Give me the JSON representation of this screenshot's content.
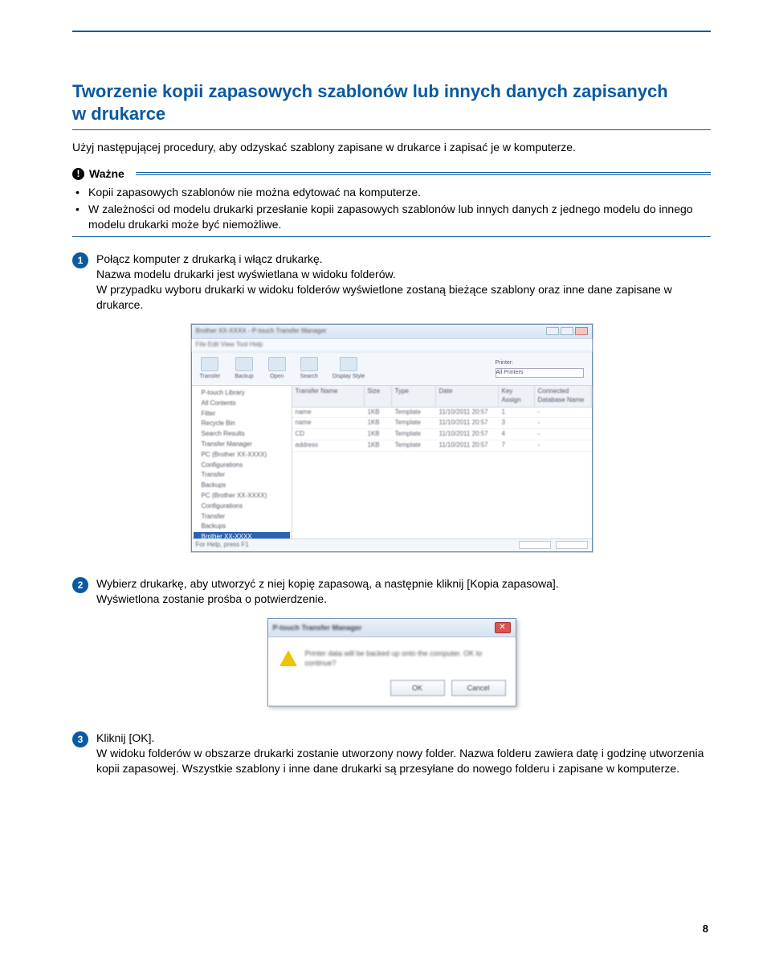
{
  "page_number": "8",
  "title_line1": "Tworzenie kopii zapasowych szablonów lub innych danych zapisanych",
  "title_line2": "w drukarce",
  "intro": "Użyj następującej procedury, aby odzyskać szablony zapisane w drukarce i zapisać je w komputerze.",
  "note": {
    "label": "Ważne",
    "items": [
      "Kopii zapasowych szablonów nie można edytować na komputerze.",
      "W zależności od modelu drukarki przesłanie kopii zapasowych szablonów lub innych danych z jednego modelu do innego modelu drukarki może być niemożliwe."
    ]
  },
  "steps": {
    "s1": {
      "num": "1",
      "p1": "Połącz komputer z drukarką i włącz drukarkę.",
      "p2": "Nazwa modelu drukarki jest wyświetlana w widoku folderów.",
      "p3": "W przypadku wyboru drukarki w widoku folderów wyświetlone zostaną bieżące szablony oraz inne dane zapisane w drukarce."
    },
    "s2": {
      "num": "2",
      "p1": "Wybierz drukarkę, aby utworzyć z niej kopię zapasową, a następnie kliknij [Kopia zapasowa].",
      "p2": "Wyświetlona zostanie prośba o potwierdzenie."
    },
    "s3": {
      "num": "3",
      "p1": "Kliknij [OK].",
      "p2": "W widoku folderów w obszarze drukarki zostanie utworzony nowy folder. Nazwa folderu zawiera datę i godzinę utworzenia kopii zapasowej. Wszystkie szablony i inne dane drukarki są przesyłane do nowego folderu i zapisane w komputerze."
    }
  },
  "tm": {
    "title": "Brother XX-XXXX - P-touch Transfer Manager",
    "menu": "File  Edit  View  Tool  Help",
    "toolbar": [
      "Transfer",
      "Backup",
      "Open",
      "Search",
      "Display Style"
    ],
    "printer_label": "Printer:",
    "printer_value": "All Printers",
    "tree": [
      "P-touch Library",
      "  All Contents",
      "  Filter",
      "  Recycle Bin",
      "  Search Results",
      "Transfer Manager",
      "  PC (Brother XX-XXXX)",
      "    Configurations",
      "    Transfer",
      "    Backups",
      "  PC (Brother XX-XXXX)",
      "    Configurations",
      "    Transfer",
      "    Backups",
      "  Brother XX-XXXX"
    ],
    "tree_selected_index": 14,
    "columns": [
      "Transfer Name",
      "Size",
      "Type",
      "Date",
      "Key Assign",
      "Connected Database Name"
    ],
    "rows": [
      [
        "name",
        "1KB",
        "Template",
        "11/10/2011 20:57",
        "1",
        "-"
      ],
      [
        "name",
        "1KB",
        "Template",
        "11/10/2011 20:57",
        "3",
        "-"
      ],
      [
        "CD",
        "1KB",
        "Template",
        "11/10/2011 20:57",
        "4",
        "-"
      ],
      [
        "address",
        "1KB",
        "Template",
        "11/10/2011 20:57",
        "7",
        "-"
      ]
    ],
    "status": "For Help, press F1"
  },
  "dialog": {
    "title": "P-touch Transfer Manager",
    "msg": "Printer data will be backed up onto the computer. OK to continue?",
    "ok": "OK",
    "cancel": "Cancel"
  }
}
